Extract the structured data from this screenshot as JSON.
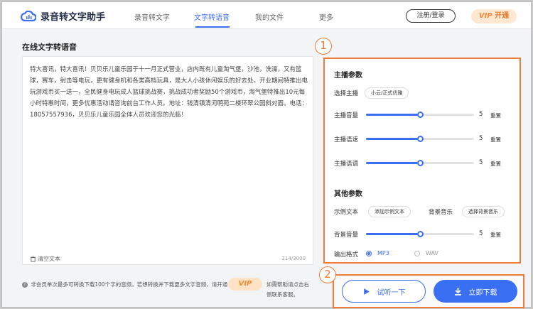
{
  "header": {
    "app_name": "录音转文字助手",
    "nav": [
      "录音转文字",
      "文字转语音",
      "我的文件",
      "更多"
    ],
    "login_label": "注册/登录",
    "vip_word": "VIP",
    "vip_action": "开通"
  },
  "left": {
    "title": "在线文字转语音",
    "body": "特大喜讯，特大喜讯！贝贝乐儿童乐园于十一月正式营业，店内既有儿童淘气堡，沙池，洗澡，又有篮球，赛车，射击等电玩，更有健身机和各类高档玩具，是大人小孩休闲娱乐的好去处。开业期间特推出电玩游戏币买一送一，全民健身电玩成人篮球挑战赛，挑战成功者奖励50个游戏币，淘气堡特推出10元每小时特惠时间，更多优惠活动请咨询前台工作人员。地址：钱清镇清河明苑二楼环翠公园斜对面。电话：18057557936，贝贝乐儿童乐园全体人员欢迎您的光临！",
    "clear_label": "清空文本",
    "char_count": "214/3000",
    "notice": "非会员单次最多可转换下载100个字的音频，若想转换并下载更多文字音频，请开通",
    "notice_vip": "VIP",
    "notice_tail": "如需帮助请点击右侧联系客服。"
  },
  "right": {
    "badge1": "1",
    "badge2": "2",
    "anchor_title": "主播参数",
    "select_anchor_label": "选择主播",
    "anchor_value": "小云/正式优雅",
    "volume_label": "主播音量",
    "speed_label": "主播语速",
    "pitch_label": "主播语调",
    "volume_val": "5",
    "speed_val": "5",
    "pitch_val": "5",
    "volume_level": 0.5,
    "speed_level": 0.5,
    "pitch_level": 0.5,
    "reset_label": "重置",
    "other_title": "其他参数",
    "sample_text_label": "示例文本",
    "add_sample_label": "添加示例文本",
    "bg_music_label": "背景音乐",
    "select_music_label": "选择背景音乐",
    "bg_volume_label": "背景音量",
    "bg_volume_val": "5",
    "bg_volume_level": 0.5,
    "format_label": "输出格式",
    "format_options": [
      "MP3",
      "WAV"
    ]
  },
  "actions": {
    "listen_label": "试听一下",
    "download_label": "立即下载"
  },
  "colors": {
    "accent": "#3b6ff3",
    "highlight": "#f07a3a",
    "vip": "#f08a34"
  }
}
